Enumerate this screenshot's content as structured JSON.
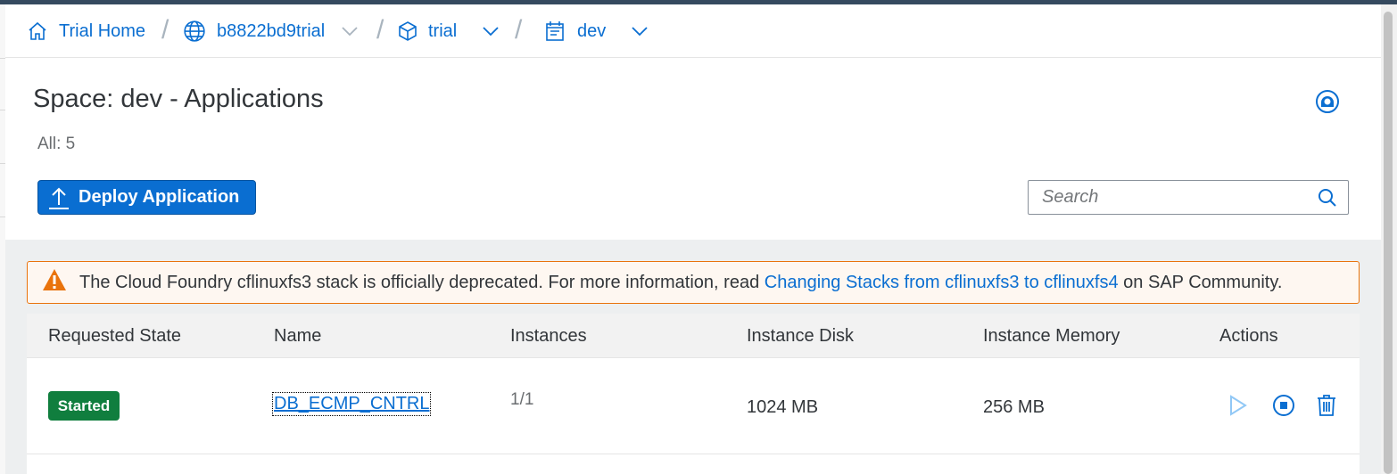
{
  "breadcrumbs": [
    {
      "label": "Trial Home",
      "icon": "home-icon"
    },
    {
      "label": "b8822bd9trial",
      "icon": "globe-icon"
    },
    {
      "label": "trial",
      "icon": "cube-icon"
    },
    {
      "label": "dev",
      "icon": "space-icon"
    }
  ],
  "page": {
    "title": "Space: dev - Applications",
    "count": "All: 5"
  },
  "toolbar": {
    "deploy_label": "Deploy Application",
    "search_placeholder": "Search"
  },
  "banner": {
    "text_before": "The Cloud Foundry cflinuxfs3 stack is officially deprecated. For more information, read ",
    "link": "Changing Stacks from cflinuxfs3 to cflinuxfs4",
    "text_after": " on SAP Community."
  },
  "table": {
    "columns": [
      "Requested State",
      "Name",
      "Instances",
      "Instance Disk",
      "Instance Memory",
      "Actions"
    ],
    "rows": [
      {
        "state": "Started",
        "name": "DB_ECMP_CNTRL",
        "instances": "1/1",
        "disk": "1024 MB",
        "memory": "256 MB"
      }
    ]
  },
  "colors": {
    "accent": "#0a6ed1",
    "success": "#107e3e",
    "warning": "#e9730c",
    "shell_bar": "#354a5f"
  }
}
